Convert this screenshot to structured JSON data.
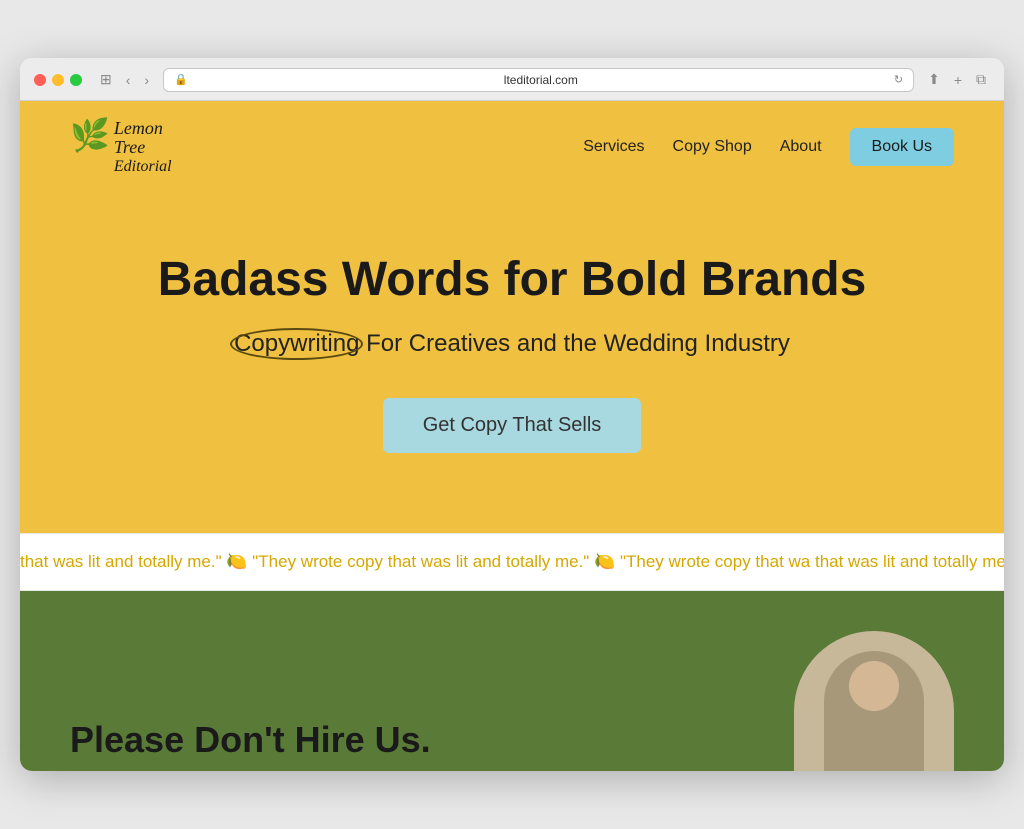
{
  "browser": {
    "url": "lteditorial.com",
    "back_label": "‹",
    "forward_label": "›",
    "reload_label": "↻",
    "share_label": "⬆",
    "new_tab_label": "+",
    "window_label": "⧉"
  },
  "header": {
    "logo_line1": "Lemon",
    "logo_line2": "Tree",
    "logo_line3": "Editorial",
    "nav": {
      "services_label": "Services",
      "copy_shop_label": "Copy Shop",
      "about_label": "About",
      "book_us_label": "Book Us"
    }
  },
  "hero": {
    "title": "Badass Words for Bold Brands",
    "subtitle_highlight": "Copywriting",
    "subtitle_rest": " For Creatives and the Wedding Industry",
    "cta_label": "Get Copy That Sells"
  },
  "ticker": {
    "text": "that was lit and totally me.\" 🍋 \"They wrote copy that was lit and totally me.\" 🍋 \"They wrote copy that wa  that was lit and totally me.\" 🍋 \"They wrote copy that was lit and totally me.\" 🍋 \"They wrote copy that wa"
  },
  "green_section": {
    "title": "Please Don't Hire Us.",
    "background_color": "#5a7a38"
  },
  "colors": {
    "hero_bg": "#f0c040",
    "nav_book_btn": "#7ecde0",
    "hero_cta_btn": "#a8d8e0",
    "ticker_text": "#d4a800",
    "green_bg": "#5a7a38"
  }
}
